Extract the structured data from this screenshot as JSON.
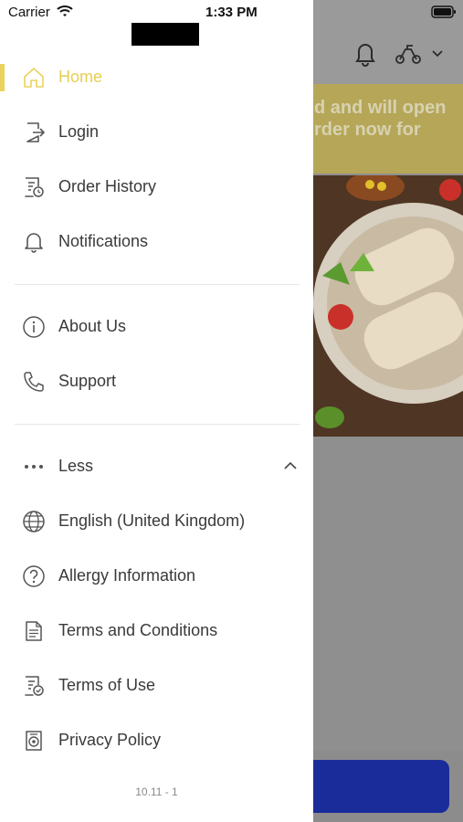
{
  "status_bar": {
    "carrier": "Carrier",
    "time": "1:33 PM"
  },
  "background": {
    "banner_text": "d and will open\nrder now for",
    "accent": "#e8d45c",
    "cta_color": "#1a2c9a"
  },
  "drawer": {
    "items": [
      {
        "label": "Home",
        "icon": "home-icon",
        "active": true
      },
      {
        "label": "Login",
        "icon": "login-icon"
      },
      {
        "label": "Order History",
        "icon": "order-history-icon"
      },
      {
        "label": "Notifications",
        "icon": "bell-icon"
      },
      {
        "label": "About Us",
        "icon": "info-icon"
      },
      {
        "label": "Support",
        "icon": "phone-icon"
      },
      {
        "label": "Less",
        "icon": "more-dots-icon"
      },
      {
        "label": "English (United Kingdom)",
        "icon": "globe-icon"
      },
      {
        "label": "Allergy Information",
        "icon": "question-icon"
      },
      {
        "label": "Terms and Conditions",
        "icon": "document-icon"
      },
      {
        "label": "Terms of Use",
        "icon": "document-check-icon"
      },
      {
        "label": "Privacy Policy",
        "icon": "privacy-icon"
      }
    ],
    "version": "10.11 - 1"
  }
}
